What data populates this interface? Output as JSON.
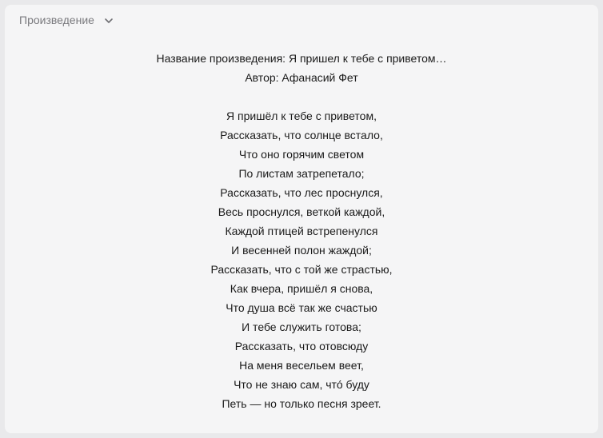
{
  "header": {
    "label": "Произведение",
    "toggle_icon": "chevron-down-icon"
  },
  "work": {
    "title_line": "Название произведения: Я пришел к тебе с приветом…",
    "author_line": "Автор: Афанасий Фет"
  },
  "poem": {
    "lines": [
      "Я пришёл к тебе с приветом,",
      "Рассказать, что солнце встало,",
      "Что оно горячим светом",
      "По листам затрепетало;",
      "Рассказать, что лес проснулся,",
      "Весь проснулся, веткой каждой,",
      "Каждой птицей встрепенулся",
      "И весенней полон жаждой;",
      "Рассказать, что с той же страстью,",
      "Как вчера, пришёл я снова,",
      "Что душа всё так же счастью",
      "И тебе служить готова;",
      "Рассказать, что отовсюду",
      "На меня весельем веет,",
      "Что не знаю сам, что́ буду",
      "Петь — но только песня зреет."
    ]
  }
}
